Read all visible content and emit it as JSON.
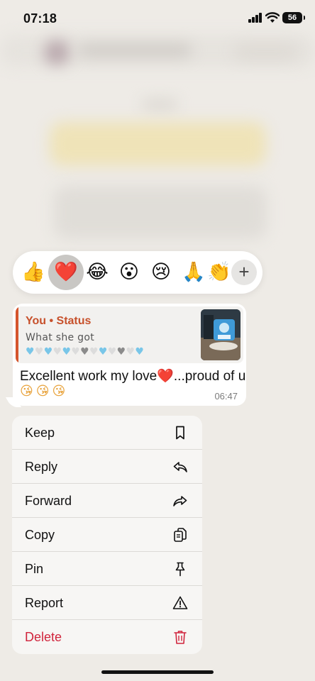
{
  "status_bar": {
    "time": "07:18",
    "battery": "56"
  },
  "reactions": {
    "items": [
      {
        "name": "thumbs-up",
        "glyph": "👍",
        "selected": false
      },
      {
        "name": "heart",
        "glyph": "❤️",
        "selected": true
      },
      {
        "name": "tears-of-joy",
        "glyph": "😂",
        "selected": false
      },
      {
        "name": "surprised",
        "glyph": "😮",
        "selected": false
      },
      {
        "name": "crying",
        "glyph": "😢",
        "selected": false
      },
      {
        "name": "folded-hands",
        "glyph": "🙏",
        "selected": false
      },
      {
        "name": "clapping",
        "glyph": "👏",
        "selected": false
      }
    ],
    "more_label": "+"
  },
  "message": {
    "quote": {
      "title": "You • Status",
      "text_prefix": "What she got ",
      "hearts": [
        "blue",
        "white",
        "blue",
        "white",
        "blue",
        "white",
        "gray",
        "white",
        "blue",
        "white",
        "gray",
        "white",
        "blue"
      ]
    },
    "text": "Excellent work my love❤️...proud of u",
    "emojis": "😘😘😘",
    "time": "06:47"
  },
  "menu": {
    "items": [
      {
        "label": "Keep",
        "icon": "bookmark-icon"
      },
      {
        "label": "Reply",
        "icon": "reply-icon"
      },
      {
        "label": "Forward",
        "icon": "forward-icon"
      },
      {
        "label": "Copy",
        "icon": "copy-icon"
      },
      {
        "label": "Pin",
        "icon": "pin-icon"
      },
      {
        "label": "Report",
        "icon": "warning-icon"
      },
      {
        "label": "Delete",
        "icon": "trash-icon"
      }
    ]
  },
  "colors": {
    "accent_quote": "#c7512c",
    "delete": "#d0243c",
    "heart": "#e0142e"
  }
}
